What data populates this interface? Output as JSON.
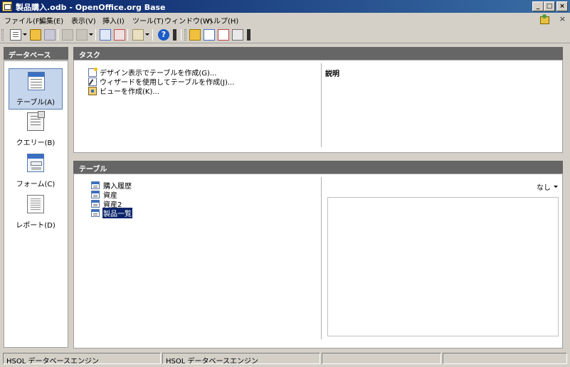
{
  "window": {
    "title": "製品購入.odb - OpenOffice.org Base",
    "minimize": "_",
    "maximize": "□",
    "close": "×"
  },
  "menu": [
    "ファイル(F)",
    "編集(E)",
    "表示(V)",
    "挿入(I)",
    "ツール(T)",
    "ウィンドウ(W)",
    "ヘルプ(H)"
  ],
  "menu_doc_close": "×",
  "toolbar": {
    "help_glyph": "?"
  },
  "sidebar": {
    "header": "データベース",
    "items": [
      {
        "label": "テーブル(A)",
        "icon": "table-icon",
        "selected": true
      },
      {
        "label": "クエリー(B)",
        "icon": "query-icon",
        "selected": false
      },
      {
        "label": "フォーム(C)",
        "icon": "form-icon",
        "selected": false
      },
      {
        "label": "レポート(D)",
        "icon": "report-icon",
        "selected": false
      }
    ]
  },
  "tasks": {
    "header": "タスク",
    "items": [
      {
        "label": "デザイン表示でテーブルを作成(G)...",
        "icon": "design-icon"
      },
      {
        "label": "ウィザードを使用してテーブルを作成(J)...",
        "icon": "wizard-icon"
      },
      {
        "label": "ビューを作成(K)...",
        "icon": "view-icon"
      }
    ],
    "description_label": "説明"
  },
  "tables": {
    "header": "テーブル",
    "items": [
      {
        "label": "購入履歴",
        "selected": false
      },
      {
        "label": "資産",
        "selected": false
      },
      {
        "label": "資産2",
        "selected": false
      },
      {
        "label": "製品一覧",
        "selected": true
      }
    ],
    "preview_option": "なし"
  },
  "status": {
    "cell1": "HSQL データベースエンジン",
    "cell2": "HSQL データベースエンジン",
    "cell3": "",
    "cell4": ""
  }
}
